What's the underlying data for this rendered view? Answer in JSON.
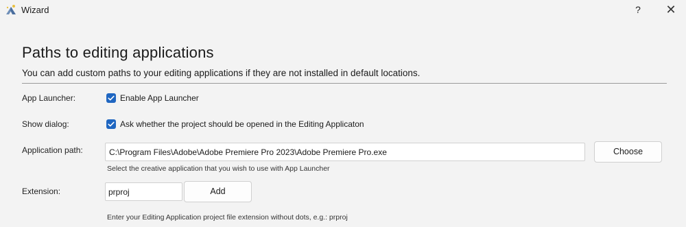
{
  "window": {
    "title": "Wizard",
    "help_label": "?",
    "close_label": "✕"
  },
  "page": {
    "heading": "Paths to editing applications",
    "subheading": "You can add custom paths to your editing applications if they are not installed in default locations."
  },
  "app_launcher": {
    "label": "App Launcher:",
    "checkbox_label": "Enable App Launcher",
    "checked": true
  },
  "show_dialog": {
    "label": "Show dialog:",
    "checkbox_label": "Ask whether the project should be opened in the Editing Applicaton",
    "checked": true
  },
  "application_path": {
    "label": "Application path:",
    "value": "C:\\Program Files\\Adobe\\Adobe Premiere Pro 2023\\Adobe Premiere Pro.exe",
    "choose_label": "Choose",
    "hint": "Select the creative application that you wish to use with App Launcher"
  },
  "extension": {
    "label": "Extension:",
    "value": "prproj",
    "add_label": "Add",
    "hint": "Enter your Editing Application project file extension without dots, e.g.: prproj"
  },
  "colors": {
    "accent": "#1f66c1",
    "background": "#f3f3f3"
  }
}
